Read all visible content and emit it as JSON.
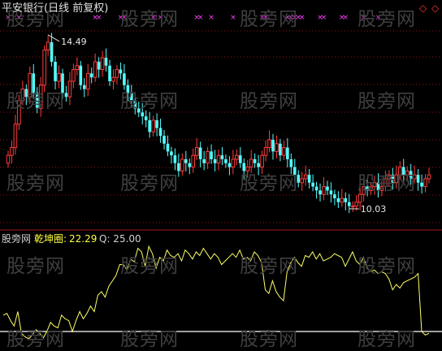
{
  "header": {
    "title": "平安银行(日线 前复权)"
  },
  "price_annotations": {
    "high_label": "14.49",
    "low_label": "10.03"
  },
  "indicator": {
    "source_label": "股旁网",
    "name_label": "乾坤圈:",
    "value_label": "22.29",
    "q_label": "Q: 25.00"
  },
  "watermark_text": "股旁网",
  "colors": {
    "background": "#000000",
    "up_candle": "#ff3c3c",
    "down_candle": "#54ffff",
    "grid": "#9a1010",
    "marker": "#ff44ff",
    "indicator_line": "#ffff66",
    "baseline": "#ffffff"
  },
  "chart_data": [
    {
      "type": "candlestick",
      "title": "平安银行(日线 前复权)",
      "ylim": [
        9.8,
        14.8
      ],
      "close": [
        11.4,
        11.6,
        12.2,
        12.8,
        13.1,
        12.9,
        13.5,
        13.0,
        12.6,
        13.2,
        14.1,
        14.3,
        13.8,
        13.3,
        13.5,
        13.0,
        12.9,
        13.3,
        13.6,
        13.7,
        13.2,
        13.1,
        13.5,
        13.4,
        13.8,
        13.6,
        13.9,
        13.7,
        13.3,
        13.4,
        13.6,
        13.5,
        13.2,
        13.0,
        12.8,
        12.6,
        12.5,
        12.4,
        12.3,
        12.0,
        12.3,
        12.1,
        11.9,
        11.7,
        11.5,
        11.4,
        11.2,
        11.0,
        11.3,
        11.2,
        11.1,
        11.4,
        11.6,
        11.3,
        11.2,
        11.5,
        11.3,
        11.2,
        11.4,
        11.3,
        11.2,
        11.1,
        11.3,
        11.4,
        11.2,
        11.0,
        11.1,
        11.3,
        11.2,
        11.1,
        11.4,
        11.6,
        11.8,
        11.5,
        11.7,
        11.4,
        11.6,
        11.3,
        11.1,
        10.9,
        10.7,
        10.8,
        10.9,
        10.7,
        10.6,
        10.5,
        10.4,
        10.6,
        10.5,
        10.4,
        10.3,
        10.2,
        10.3,
        10.2,
        10.1,
        10.1,
        10.2,
        10.4,
        10.6,
        10.5,
        10.6,
        10.7,
        10.5,
        10.6,
        10.8,
        10.9,
        10.7,
        10.9,
        11.1,
        10.9,
        11.0,
        10.8,
        10.9,
        10.7,
        10.6,
        10.8,
        10.9
      ],
      "high_label": 14.49,
      "low_label": 10.03
    },
    {
      "type": "line",
      "title": "乾坤圈",
      "ylim": [
        0,
        115
      ],
      "baseline": 18,
      "values": [
        36,
        38,
        30,
        24,
        40,
        16,
        12,
        10,
        14,
        20,
        16,
        11,
        18,
        28,
        24,
        22,
        36,
        32,
        30,
        18,
        30,
        40,
        32,
        38,
        46,
        40,
        58,
        62,
        56,
        68,
        74,
        80,
        92,
        92,
        86,
        98,
        95,
        110,
        106,
        90,
        112,
        104,
        88,
        100,
        96,
        108,
        102,
        100,
        104,
        96,
        108,
        104,
        98,
        106,
        102,
        110,
        104,
        98,
        104,
        100,
        92,
        96,
        100,
        104,
        100,
        108,
        98,
        100,
        96,
        106,
        102,
        94,
        64,
        60,
        74,
        62,
        56,
        52,
        84,
        94,
        100,
        94,
        90,
        102,
        100,
        106,
        98,
        104,
        96,
        98,
        100,
        104,
        102,
        100,
        90,
        98,
        106,
        96,
        92,
        100,
        88,
        84,
        86,
        82,
        84,
        82,
        76,
        64,
        70,
        66,
        72,
        74,
        76,
        78,
        82,
        18,
        14,
        16
      ]
    }
  ]
}
